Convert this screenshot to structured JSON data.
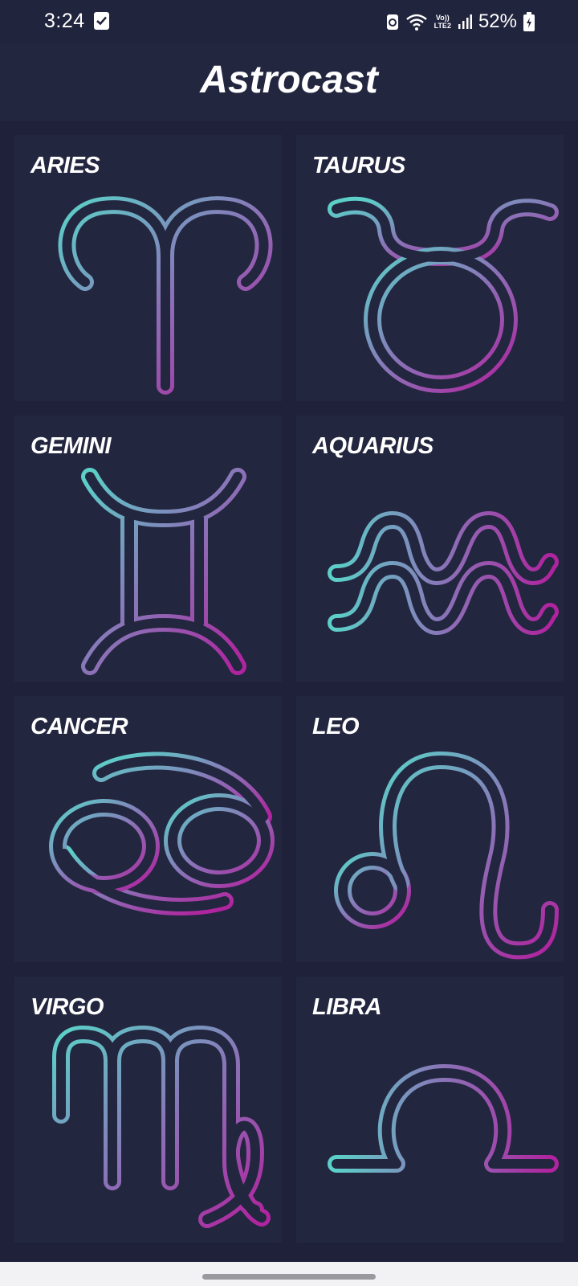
{
  "status_bar": {
    "time": "3:24",
    "volte_line1": "Vo))",
    "volte_line2": "LTE2",
    "battery": "52%",
    "icons": [
      "check-notification-icon",
      "recycle-icon",
      "wifi-icon",
      "volte-icon",
      "signal-icon",
      "battery-icon"
    ]
  },
  "app": {
    "title": "Astrocast"
  },
  "signs": [
    {
      "label": "ARIES"
    },
    {
      "label": "TAURUS"
    },
    {
      "label": "GEMINI"
    },
    {
      "label": "AQUARIUS"
    },
    {
      "label": "CANCER"
    },
    {
      "label": "LEO"
    },
    {
      "label": "VIRGO"
    },
    {
      "label": "LIBRA"
    }
  ],
  "colors": {
    "background": "#1e2139",
    "card": "#23263f",
    "gradient_start": "#5ccfc8",
    "gradient_mid": "#8a74b8",
    "gradient_end": "#b0249f"
  }
}
